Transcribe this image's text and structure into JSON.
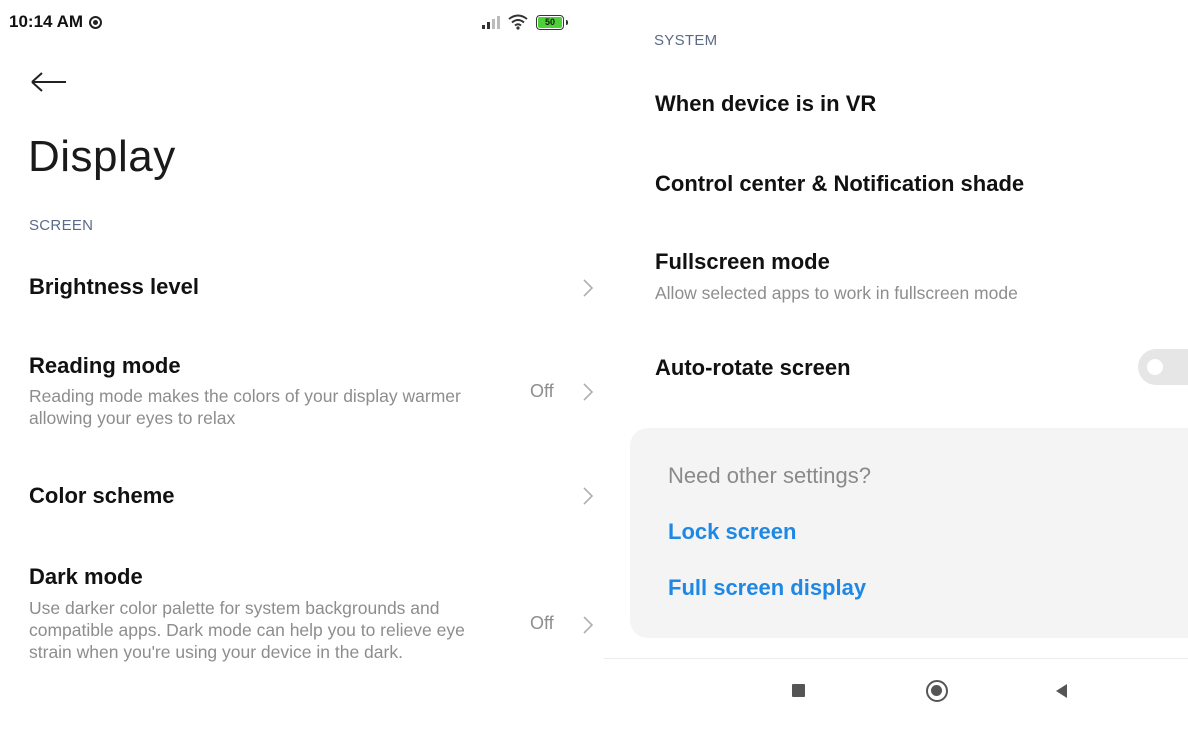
{
  "status_bar": {
    "time": "10:14 AM",
    "battery_level": "50"
  },
  "left_panel": {
    "title": "Display",
    "section_screen": "SCREEN",
    "items": [
      {
        "title": "Brightness level",
        "subtitle": "",
        "value": ""
      },
      {
        "title": "Reading mode",
        "subtitle": "Reading mode makes the colors of your display warmer allowing your eyes to relax",
        "value": "Off"
      },
      {
        "title": "Color scheme",
        "subtitle": "",
        "value": ""
      },
      {
        "title": "Dark mode",
        "subtitle": "Use darker color palette for system backgrounds and compatible apps. Dark mode can help you to relieve eye strain when you're using your device in the dark.",
        "value": "Off"
      }
    ]
  },
  "right_panel": {
    "section_system": "SYSTEM",
    "items": [
      {
        "title": "When device is in VR"
      },
      {
        "title": "Control center & Notification shade"
      },
      {
        "title": "Fullscreen mode",
        "subtitle": "Allow selected apps to work in fullscreen mode"
      },
      {
        "title": "Auto-rotate screen",
        "toggle_on": false
      }
    ],
    "card": {
      "title": "Need other settings?",
      "links": [
        "Lock screen",
        "Full screen display"
      ]
    }
  },
  "colors": {
    "accent_link": "#1e88e5",
    "section_header": "#5b6a86",
    "secondary_text": "#8d8d8d",
    "battery_green": "#4cd137"
  },
  "icons": {
    "back": "arrow-left-icon",
    "chevron": "chevron-right-icon",
    "nav_recents": "square-icon",
    "nav_home": "circle-icon",
    "nav_back": "triangle-left-icon"
  }
}
